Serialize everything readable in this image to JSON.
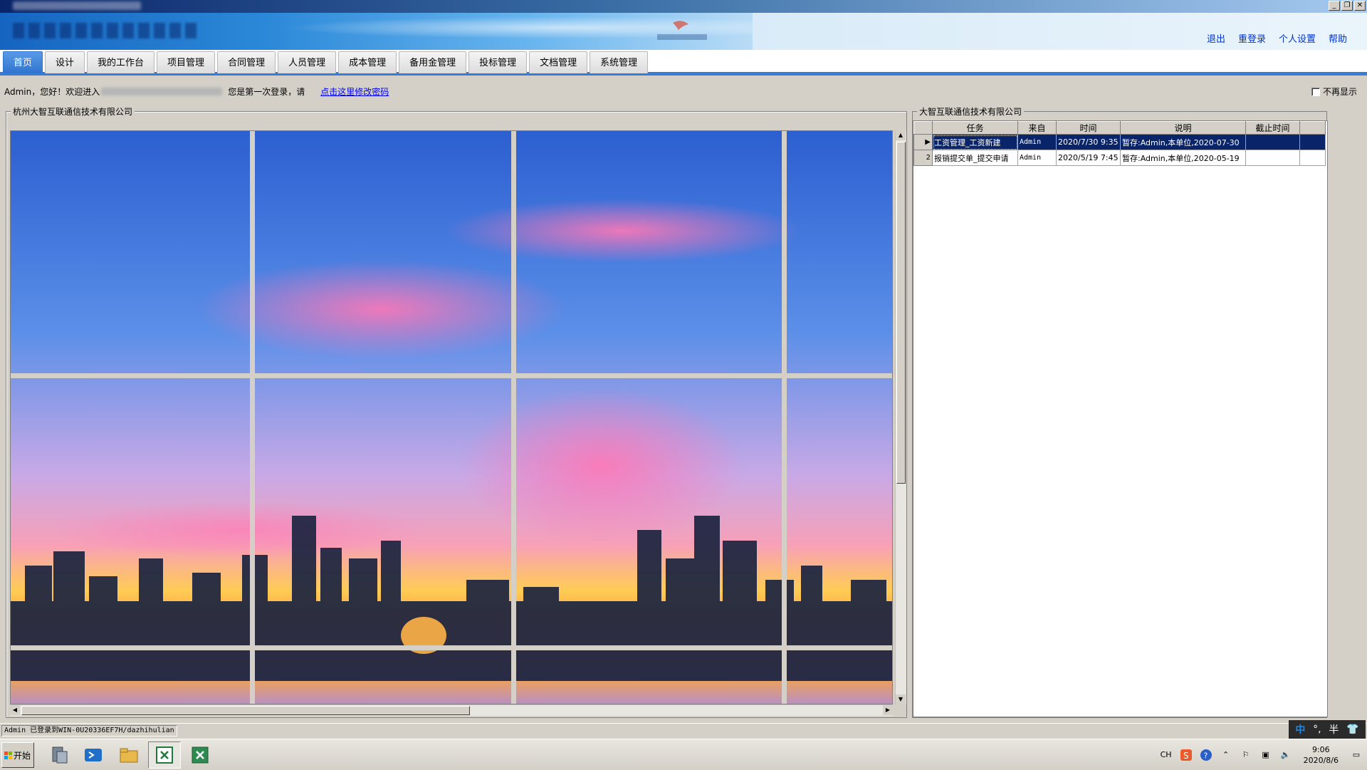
{
  "window": {
    "controls": {
      "minimize": "_",
      "restore": "❐",
      "close": "✕"
    }
  },
  "header": {
    "links": [
      {
        "label": "退出"
      },
      {
        "label": "重登录"
      },
      {
        "label": "个人设置"
      },
      {
        "label": "帮助"
      }
    ]
  },
  "tabs": [
    {
      "label": "首页",
      "active": true
    },
    {
      "label": "设计"
    },
    {
      "label": "我的工作台"
    },
    {
      "label": "项目管理"
    },
    {
      "label": "合同管理"
    },
    {
      "label": "人员管理"
    },
    {
      "label": "成本管理"
    },
    {
      "label": "备用金管理"
    },
    {
      "label": "投标管理"
    },
    {
      "label": "文档管理"
    },
    {
      "label": "系统管理"
    }
  ],
  "welcome": {
    "greeting": "Admin，您好！欢迎进入",
    "first_login": "您是第一次登录，请",
    "change_password_link": "点击这里修改密码",
    "no_show_label": "不再显示"
  },
  "left_panel": {
    "title": "杭州大智互联通信技术有限公司"
  },
  "right_panel": {
    "title": "大智互联通信技术有限公司",
    "columns": [
      "任务",
      "来自",
      "时间",
      "说明",
      "截止时间"
    ],
    "rows": [
      {
        "indicator": "▶",
        "task": "工资管理_工资新建",
        "from": "Admin",
        "time": "2020/7/30 9:35",
        "desc": "暂存:Admin,本单位,2020-07-30",
        "deadline": "",
        "selected": true
      },
      {
        "indicator": "2",
        "task": "报销提交单_提交申请",
        "from": "Admin",
        "time": "2020/5/19 7:45",
        "desc": "暂存:Admin,本单位,2020-05-19",
        "deadline": "",
        "selected": false
      }
    ]
  },
  "status_bar": {
    "text": "Admin 已登录到WIN-0U20336EF7H/dazhihulian"
  },
  "ime": {
    "mode": "中",
    "punct": "°,",
    "width": "半"
  },
  "taskbar": {
    "start_label": "开始",
    "tray": {
      "lang": "CH",
      "time": "9:06",
      "date": "2020/8/6"
    }
  },
  "colors": {
    "accent": "#3a7bd5",
    "selected_row": "#0a246a",
    "link": "#0033cc"
  }
}
